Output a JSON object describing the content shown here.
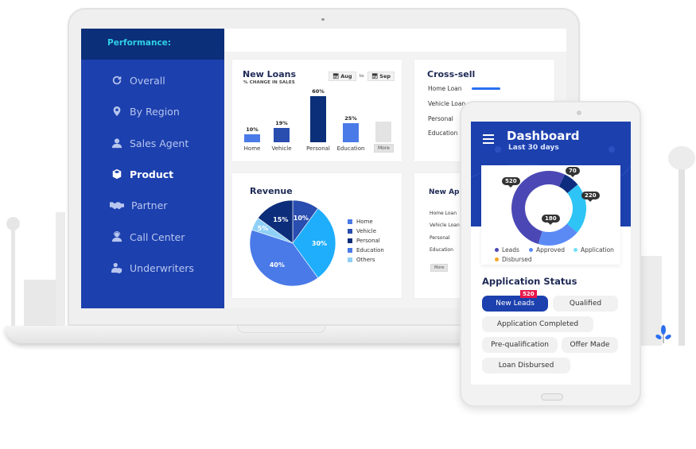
{
  "laptop": {
    "sidebar": {
      "header": "Performance:",
      "items": [
        {
          "label": "Overall",
          "icon": "refresh-icon",
          "active": false
        },
        {
          "label": "By Region",
          "icon": "map-pin-icon",
          "active": false
        },
        {
          "label": "Sales Agent",
          "icon": "user-icon",
          "active": false
        },
        {
          "label": "Product",
          "icon": "box-icon",
          "active": true
        },
        {
          "label": "Partner",
          "icon": "handshake-icon",
          "active": false
        },
        {
          "label": "Call Center",
          "icon": "headset-agent-icon",
          "active": false
        },
        {
          "label": "Underwriters",
          "icon": "user-shield-icon",
          "active": false
        }
      ]
    },
    "new_loans": {
      "title": "New Loans",
      "subtitle": "% CHANGE IN SALES",
      "from": "Aug",
      "to_label": "to",
      "to": "Sep",
      "more_label": "More"
    },
    "cross_sell": {
      "title": "Cross-sell",
      "items": [
        "Home Loan",
        "Vehicle Loan",
        "Personal",
        "Education"
      ],
      "home_loan_progress": 1.0
    },
    "revenue": {
      "title": "Revenue"
    },
    "new_applications": {
      "title": "New Applications",
      "items": [
        "Home Loan",
        "Vehicle Loan",
        "Personal",
        "Education"
      ],
      "more_label": "More"
    }
  },
  "phone": {
    "title": "Dashboard",
    "subtitle": "Last 30 days",
    "application_status": {
      "title": "Application Status",
      "pills": [
        {
          "label": "New Leads",
          "active": true,
          "badge": "520"
        },
        {
          "label": "Qualified",
          "active": false
        },
        {
          "label": "Application Completed",
          "active": false
        },
        {
          "label": "Pre-qualification",
          "active": false
        },
        {
          "label": "Offer Made",
          "active": false
        },
        {
          "label": "Loan Disbursed",
          "active": false
        }
      ]
    }
  },
  "chart_data": [
    {
      "type": "bar",
      "title": "New Loans",
      "subtitle": "% CHANGE IN SALES",
      "categories": [
        "Home",
        "Vehicle",
        "Personal",
        "Education",
        "More"
      ],
      "values": [
        10,
        19,
        60,
        25,
        null
      ],
      "labels": [
        "10%",
        "19%",
        "60%",
        "25%",
        ""
      ],
      "colors": [
        "#4a7ae8",
        "#2a4db0",
        "#0b2f79",
        "#4a7ae8",
        "#e3e3e3"
      ],
      "ylim": [
        0,
        60
      ]
    },
    {
      "type": "pie",
      "title": "Revenue",
      "slices": [
        {
          "name": "Vehicle",
          "value": 10,
          "label": "10%",
          "color": "#2a4db0"
        },
        {
          "name": "Home",
          "value": 30,
          "label": "30%",
          "color": "#1eaefc"
        },
        {
          "name": "Education",
          "value": 40,
          "label": "40%",
          "color": "#4a7ae8"
        },
        {
          "name": "Others",
          "value": 5,
          "label": "5%",
          "color": "#8fd0f7"
        },
        {
          "name": "Personal",
          "value": 15,
          "label": "15%",
          "color": "#0c2d7a"
        }
      ],
      "legend": [
        {
          "name": "Home",
          "color": "#4a7ae8"
        },
        {
          "name": "Vehicle",
          "color": "#2a4db0"
        },
        {
          "name": "Personal",
          "color": "#0c2d7a"
        },
        {
          "name": "Education",
          "color": "#4a7ae8"
        },
        {
          "name": "Others",
          "color": "#8fd0f7"
        }
      ],
      "legend_position": "right"
    },
    {
      "type": "pie",
      "variant": "donut",
      "title": "Dashboard - Last 30 days",
      "slices": [
        {
          "name": "Leads",
          "value": 520,
          "label": "520",
          "color": "#4b48b5"
        },
        {
          "name": "Disbursed",
          "value": 70,
          "label": "70",
          "color": "#0d2c7e"
        },
        {
          "name": "Application",
          "value": 220,
          "label": "220",
          "color": "#2ec4f5"
        },
        {
          "name": "Approved",
          "value": 180,
          "label": "180",
          "color": "#5b8af5"
        }
      ],
      "legend": [
        {
          "name": "Leads",
          "color": "#4b48b5"
        },
        {
          "name": "Approved",
          "color": "#5b8af5"
        },
        {
          "name": "Application",
          "color": "#74e0f7"
        },
        {
          "name": "Disbursed",
          "color": "#f5a623"
        }
      ],
      "legend_position": "bottom"
    }
  ]
}
